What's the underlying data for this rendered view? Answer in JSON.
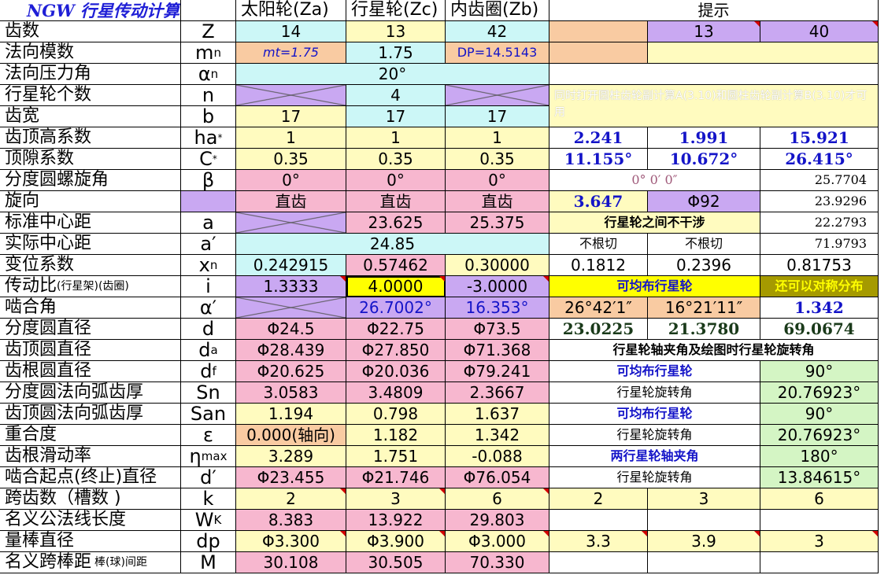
{
  "header": {
    "title": "NGW 行星传动计算",
    "sun": "太阳轮(Za)",
    "planet": "行星轮(Zc)",
    "ring": "内齿圈(Zb)",
    "hint": "提示"
  },
  "rows": {
    "teeth": {
      "label": "齿数",
      "sym": "Z",
      "za": "14",
      "zc": "13",
      "zb": "42",
      "h2": "13",
      "h3": "40"
    },
    "module": {
      "label": "法向模数",
      "sym": "m",
      "sub": "n",
      "za": "mt=1.75",
      "zc": "1.75",
      "zb": "DP=14.5143"
    },
    "pressure": {
      "label": "法向压力角",
      "sym": "α",
      "sub": "n",
      "val": "20°"
    },
    "planet_count": {
      "label": "行星轮个数",
      "sym": "n",
      "zc": "4",
      "note": "同时打开圆柱齿轮副计算A(3.10)和圆柱齿轮副计算B(3.10)才可用"
    },
    "width": {
      "label": "齿宽",
      "sym": "b",
      "za": "17",
      "zc": "17",
      "zb": "17"
    },
    "addendum": {
      "label": "齿顶高系数",
      "sym": "ha",
      "sup": "*",
      "za": "1",
      "zc": "1",
      "zb": "1",
      "h1": "2.241",
      "h2": "1.991",
      "h3": "15.921"
    },
    "clearance": {
      "label": "顶隙系数",
      "sym": "C",
      "sup": "*",
      "za": "0.35",
      "zc": "0.35",
      "zb": "0.35",
      "h1": "11.155°",
      "h2": "10.672°",
      "h3": "26.415°"
    },
    "helix": {
      "label": "分度圆螺旋角",
      "sym": "β",
      "za": "0°",
      "zc": "0°",
      "zb": "0°",
      "h12": "0° 0′ 0″",
      "h3": "25.7704"
    },
    "hand": {
      "label": "旋向",
      "za": "直齿",
      "zc": "直齿",
      "zb": "直齿",
      "h1": "3.647",
      "h2": "Φ92",
      "h3": "23.9296"
    },
    "std_center": {
      "label": "标准中心距",
      "sym": "a",
      "zc": "23.625",
      "zb": "25.375",
      "h12": "行星轮之间不干涉",
      "h3": "22.2793"
    },
    "act_center": {
      "label": "实际中心距",
      "sym": "a′",
      "val": "24.85",
      "h1": "不根切",
      "h2": "不根切",
      "h3": "71.9793"
    },
    "shift": {
      "label": "变位系数",
      "sym": "x",
      "sub": "n",
      "za": "0.242915",
      "zc": "0.57462",
      "zb": "0.30000",
      "h1": "0.1812",
      "h2": "0.2396",
      "h3": "0.81753"
    },
    "ratio": {
      "label": "传动比",
      "label_sm": "(行星架)(齿圈)",
      "sym": "i",
      "za": "1.3333",
      "zc": "4.0000",
      "zb": "-3.0000",
      "h12": "可均布行星轮",
      "h3": "还可以对称分布"
    },
    "mesh_angle": {
      "label": "啮合角",
      "sym": "α′",
      "zc": "26.7002°",
      "zb": "16.353°",
      "h1": "26°42′1″",
      "h2": "16°21′11″",
      "h3": "1.342"
    },
    "pitch": {
      "label": "分度圆直径",
      "sym": "d",
      "za": "Φ24.5",
      "zc": "Φ22.75",
      "zb": "Φ73.5",
      "h1": "23.0225",
      "h2": "21.3780",
      "h3": "69.0674"
    },
    "tip": {
      "label": "齿顶圆直径",
      "sym": "d",
      "sub": "a",
      "za": "Φ28.439",
      "zc": "Φ27.850",
      "zb": "Φ71.368",
      "h123": "行星轮轴夹角及绘图时行星轮旋转角"
    },
    "root": {
      "label": "齿根圆直径",
      "sym": "d",
      "sub": "f",
      "za": "Φ20.625",
      "zc": "Φ20.036",
      "zb": "Φ79.241",
      "h12": "可均布行星轮",
      "h3": "90°"
    },
    "arc_thick": {
      "label": "分度圆法向弧齿厚",
      "sym": "Sn",
      "za": "3.0583",
      "zc": "3.4809",
      "zb": "2.3667",
      "h12": "行星轮旋转角",
      "h3": "20.76923°"
    },
    "tip_thick": {
      "label": "齿顶圆法向弧齿厚",
      "sym": "San",
      "za": "1.194",
      "zc": "0.798",
      "zb": "1.637",
      "h12": "可均布行星轮",
      "h3": "90°"
    },
    "overlap": {
      "label": "重合度",
      "sym": "ε",
      "za": "0.000(轴向)",
      "zc": "1.182",
      "zb": "1.342",
      "h12": "行星轮旋转角",
      "h3": "20.76923°"
    },
    "slide": {
      "label": "齿根滑动率",
      "sym": "η",
      "sub": "max",
      "za": "3.289",
      "zc": "1.751",
      "zb": "-0.088",
      "h12": "两行星轮轴夹角",
      "h3": "180°"
    },
    "mesh_start": {
      "label": "啮合起点(终止)直径",
      "sym": "d′",
      "za": "Φ23.455",
      "zc": "Φ21.746",
      "zb": "Φ76.054",
      "h12": "行星轮旋转角",
      "h3": "13.84615°"
    },
    "span_teeth": {
      "label": "跨齿数（槽数 )",
      "sym": "k",
      "za": "2",
      "zc": "3",
      "zb": "6",
      "h1": "2",
      "h2": "3",
      "h3": "6"
    },
    "base_tangent": {
      "label": "名义公法线长度",
      "sym": "W",
      "sub": "K",
      "za": "8.383",
      "zc": "13.922",
      "zb": "29.803"
    },
    "pin_dia": {
      "label": "量棒直径",
      "sym": "dp",
      "za": "Φ3.300",
      "zc": "Φ3.900",
      "zb": "Φ3.000",
      "h1": "3.3",
      "h2": "3.9",
      "h3": "3"
    },
    "pin_dist": {
      "label": "名义跨棒距",
      "label_sm": "棒(球)间距",
      "sym": "M",
      "za": "30.108",
      "zc": "30.505",
      "zb": "70.330"
    }
  }
}
